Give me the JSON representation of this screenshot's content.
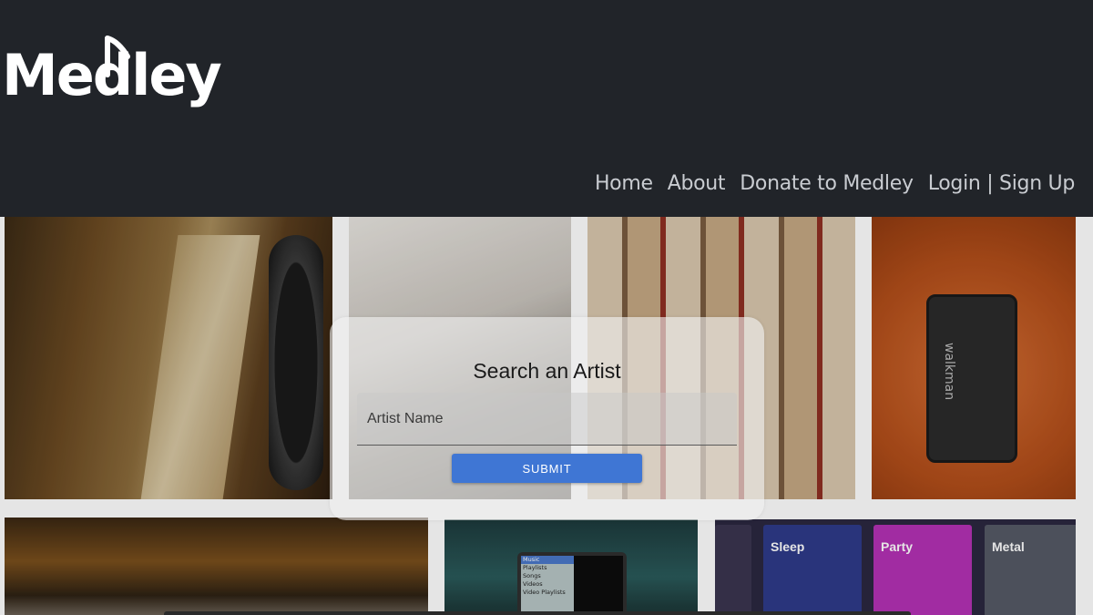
{
  "brand": {
    "logo_text": "Medley",
    "logo_icon": "music-note-icon"
  },
  "nav": {
    "home": "Home",
    "about": "About",
    "donate": "Donate to Medley",
    "login": "Login",
    "separator": " | ",
    "signup": "Sign Up"
  },
  "search": {
    "title": "Search an Artist",
    "placeholder": "Artist Name",
    "value": "",
    "submit_label": "SUBMIT"
  },
  "gallery": {
    "walkman_label": "walkman",
    "ipod_menu": [
      "Music",
      "Playlists",
      "Songs",
      "Videos",
      "Video Playlists"
    ],
    "playlists": [
      "Sleep",
      "Party",
      "Metal"
    ]
  },
  "colors": {
    "header_bg": "#212429",
    "nav_text": "#c9ccd1",
    "accent": "#3f76d4"
  }
}
